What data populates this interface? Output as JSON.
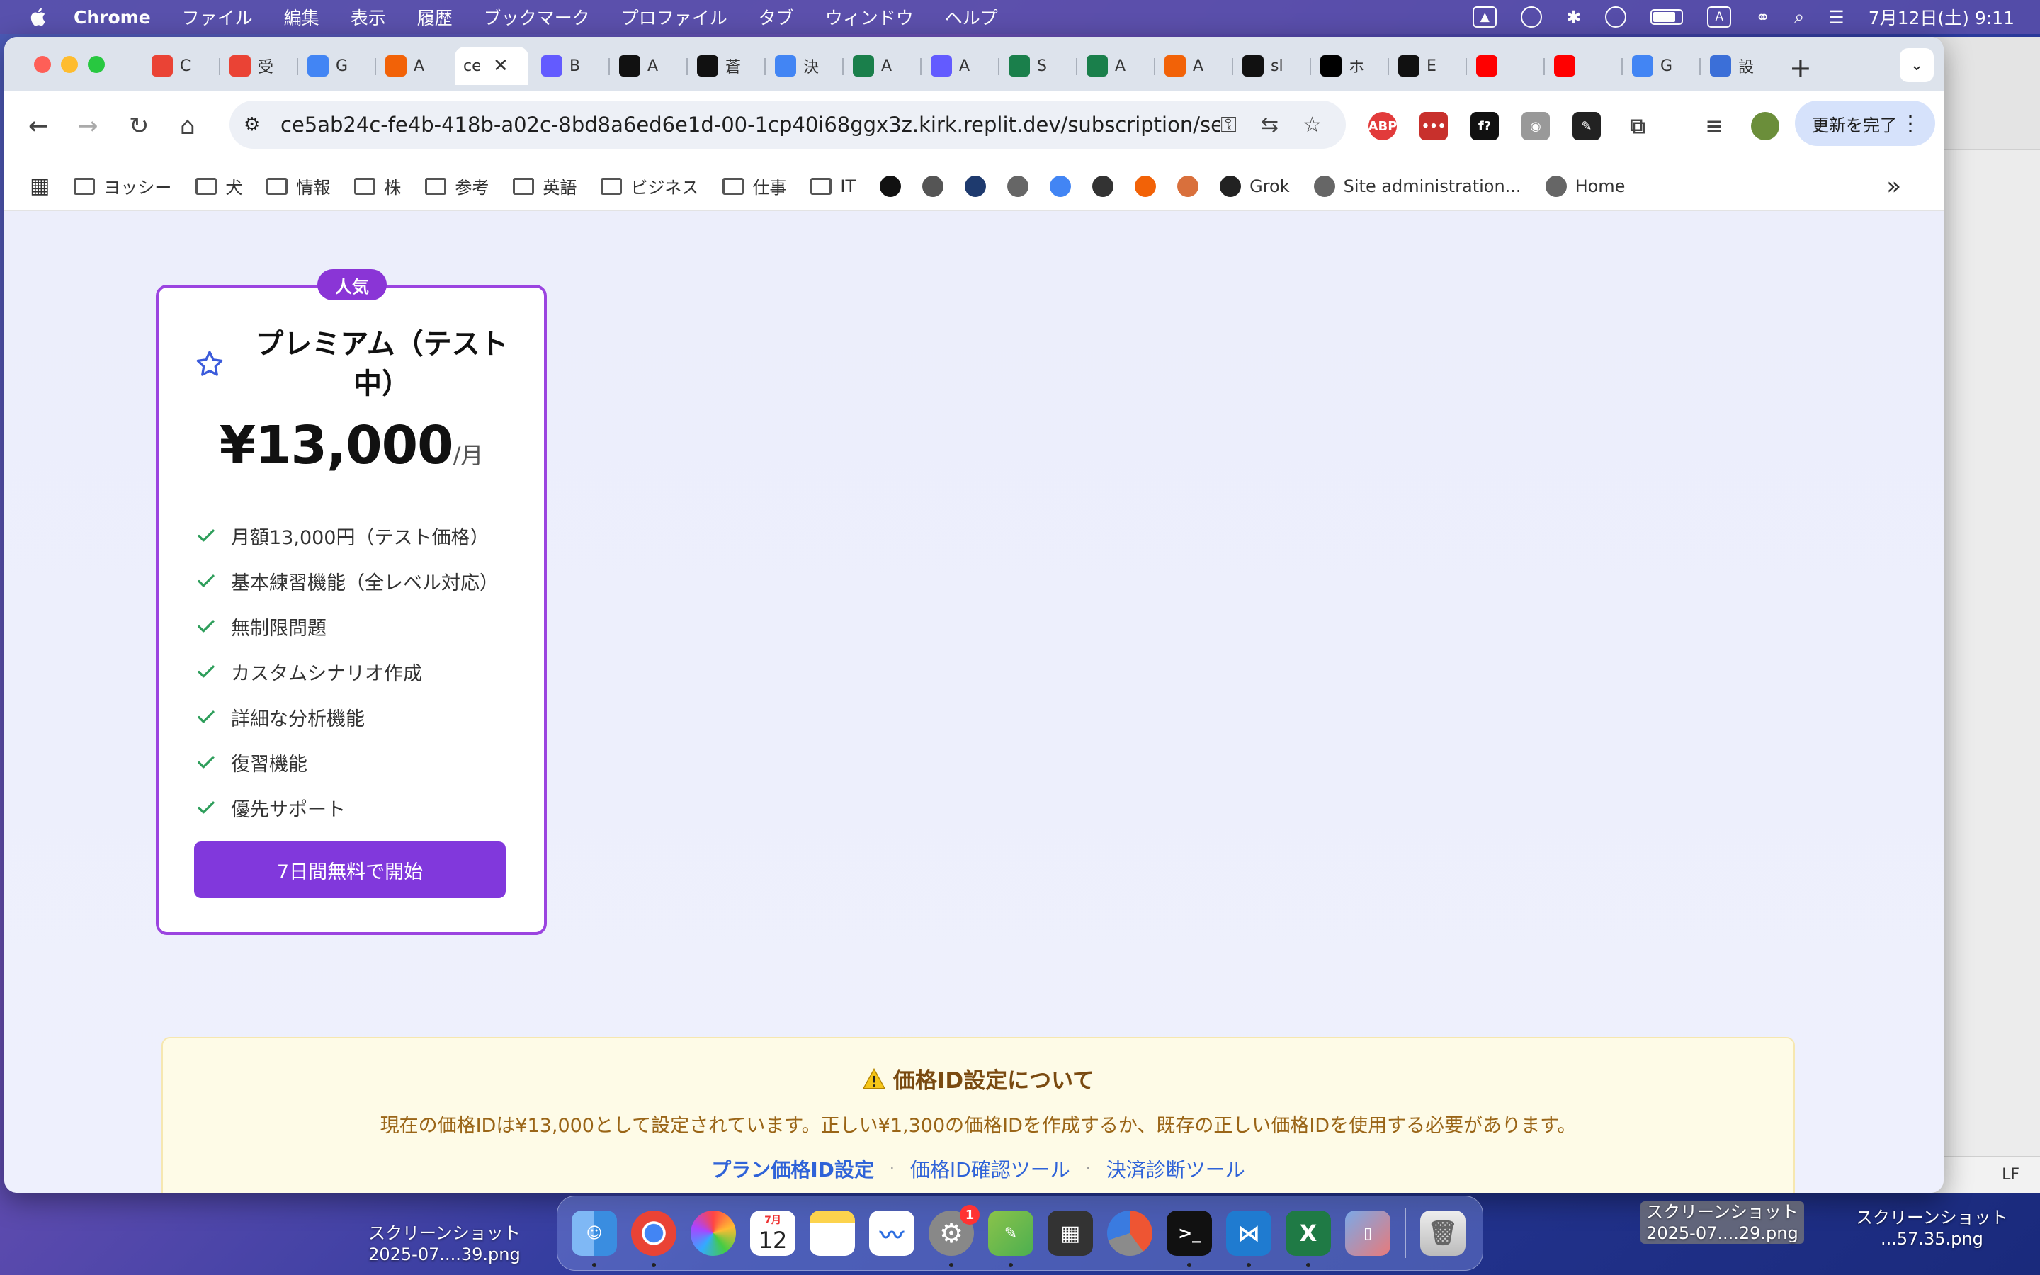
{
  "menubar": {
    "app_name": "Chrome",
    "menus": [
      "ファイル",
      "編集",
      "表示",
      "履歴",
      "ブックマーク",
      "プロファイル",
      "タブ",
      "ウィンドウ",
      "ヘルプ"
    ],
    "input_indicator": "A",
    "clock": "7月12日(土) 9:11"
  },
  "tabs": [
    {
      "icon": "gmail-icon",
      "label": "C"
    },
    {
      "icon": "gmail-icon",
      "label": "受"
    },
    {
      "icon": "calendar-icon",
      "label": "G"
    },
    {
      "icon": "replit-icon",
      "label": "A"
    },
    {
      "icon": "replit-icon",
      "label": "ce",
      "active": true
    },
    {
      "icon": "stripe-icon",
      "label": "B"
    },
    {
      "icon": "chatgpt-icon",
      "label": "A"
    },
    {
      "icon": "chatgpt-icon",
      "label": "蒼"
    },
    {
      "icon": "google-icon",
      "label": "決"
    },
    {
      "icon": "app-icon",
      "label": "A"
    },
    {
      "icon": "stripe-icon",
      "label": "A"
    },
    {
      "icon": "app-icon",
      "label": "S"
    },
    {
      "icon": "app-icon",
      "label": "A"
    },
    {
      "icon": "replit-icon",
      "label": "A"
    },
    {
      "icon": "github-icon",
      "label": "sl"
    },
    {
      "icon": "x-icon",
      "label": "ホ"
    },
    {
      "icon": "notion-icon",
      "label": "E"
    },
    {
      "icon": "youtube-icon",
      "label": ""
    },
    {
      "icon": "youtube-icon",
      "label": ""
    },
    {
      "icon": "translate-icon",
      "label": "G"
    },
    {
      "icon": "settings-icon",
      "label": "設"
    }
  ],
  "toolbar": {
    "url": "ce5ab24c-fe4b-418b-a02c-8bd8a6ed6e1d-00-1cp40i68ggx3z.kirk.replit.dev/subscription/sel...",
    "update_label": "更新を完了"
  },
  "bookmarks": [
    {
      "type": "folder",
      "label": "ヨッシー"
    },
    {
      "type": "folder",
      "label": "犬"
    },
    {
      "type": "folder",
      "label": "情報"
    },
    {
      "type": "folder",
      "label": "株"
    },
    {
      "type": "folder",
      "label": "参考"
    },
    {
      "type": "folder",
      "label": "英語"
    },
    {
      "type": "folder",
      "label": "ビジネス"
    },
    {
      "type": "folder",
      "label": "仕事"
    },
    {
      "type": "folder",
      "label": "IT"
    },
    {
      "type": "link",
      "label": "Grok"
    },
    {
      "type": "link",
      "label": "Site administration..."
    },
    {
      "type": "link",
      "label": "Home"
    }
  ],
  "plan": {
    "badge": "人気",
    "title": "プレミアム（テスト中）",
    "price": "¥13,000",
    "period": "/月",
    "features": [
      "月額13,000円（テスト価格）",
      "基本練習機能（全レベル対応）",
      "無制限問題",
      "カスタムシナリオ作成",
      "詳細な分析機能",
      "復習機能",
      "優先サポート"
    ],
    "cta_label": "7日間無料で開始",
    "accent_color": "#8138dc"
  },
  "notice": {
    "title": "価格ID設定について",
    "body": "現在の価格IDは¥13,000として設定されています。正しい¥1,300の価格IDを作成するか、既存の正しい価格IDを使用する必要があります。",
    "links": [
      "プラン価格ID設定",
      "価格ID確認ツール",
      "決済診断ツール"
    ],
    "separator": "·"
  },
  "side_window": {
    "status": "LF"
  },
  "dock": {
    "calendar_month": "7月",
    "calendar_day": "12",
    "settings_badge": "1"
  },
  "desktop_labels": [
    {
      "line1": "スクリーンショット",
      "line2": "2025-07....39.png"
    },
    {
      "line1": "スクリーンショット",
      "line2": "2025-07....29.png"
    },
    {
      "line1": "スクリーンショット",
      "line2": "...57.35.png"
    }
  ]
}
